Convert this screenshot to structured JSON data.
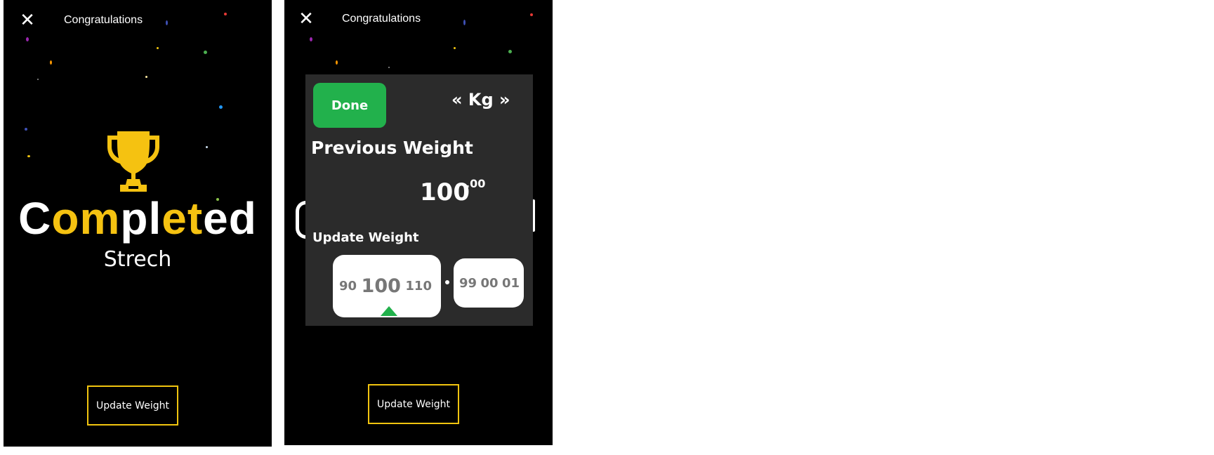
{
  "header": {
    "title": "Congratulations",
    "close_icon": "close-icon"
  },
  "completion": {
    "word_parts": [
      {
        "text": "C",
        "color": "#ffffff"
      },
      {
        "text": "om",
        "color": "#f5c211"
      },
      {
        "text": "pl",
        "color": "#ffffff"
      },
      {
        "text": "et",
        "color": "#f5c211"
      },
      {
        "text": "ed",
        "color": "#ffffff"
      }
    ],
    "exercise": "Strech",
    "icon": "trophy-icon"
  },
  "actions": {
    "update_weight_label": "Update Weight"
  },
  "weight_panel": {
    "done_label": "Done",
    "unit_label": "« Kg »",
    "previous_label": "Previous Weight",
    "previous_value": "100",
    "previous_decimal": ".00",
    "update_label": "Update Weight",
    "picker_main": [
      "90",
      "100",
      "110"
    ],
    "picker_decimal": [
      "99",
      "00",
      "01"
    ]
  },
  "colors": {
    "accent_yellow": "#f5c211",
    "done_green": "#22b14c",
    "panel_bg": "#2b2b2b"
  }
}
